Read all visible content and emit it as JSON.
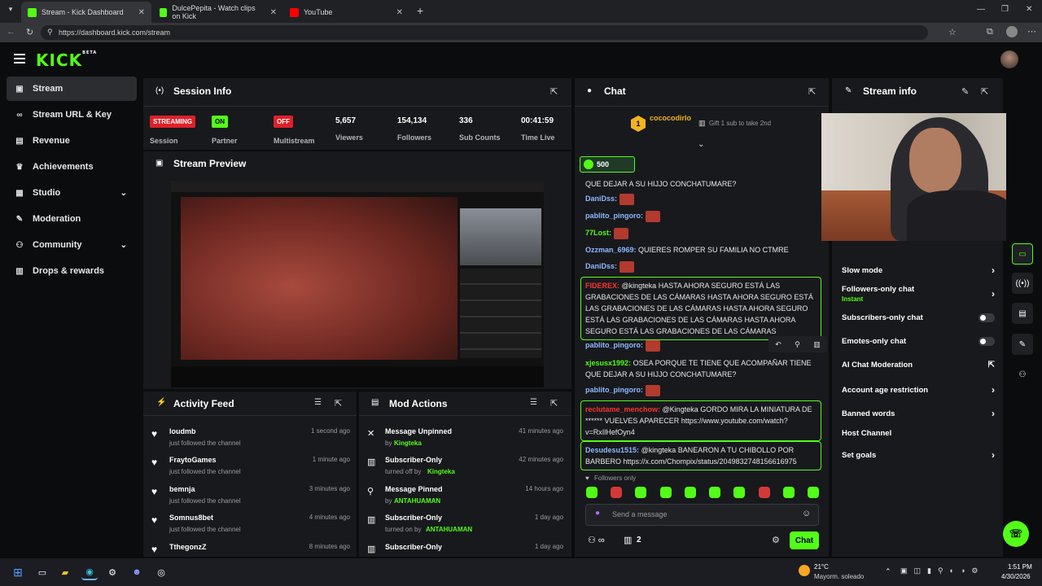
{
  "browser": {
    "tabs": [
      {
        "label": "Stream - Kick Dashboard",
        "icon": "kick-icon"
      },
      {
        "label": "DulcePepita - Watch clips on Kick",
        "icon": "kick-icon"
      },
      {
        "label": "YouTube",
        "icon": "youtube-icon"
      }
    ],
    "url": "https://dashboard.kick.com/stream"
  },
  "app": {
    "logo": "KICK",
    "logo_sup": "BETA"
  },
  "sidebar": {
    "items": [
      {
        "label": "Stream",
        "icon": "stream-icon"
      },
      {
        "label": "Stream URL & Key",
        "icon": "link-icon"
      },
      {
        "label": "Revenue",
        "icon": "revenue-icon"
      },
      {
        "label": "Achievements",
        "icon": "trophy-icon"
      },
      {
        "label": "Studio",
        "icon": "studio-icon"
      },
      {
        "label": "Moderation",
        "icon": "wrench-icon"
      },
      {
        "label": "Community",
        "icon": "community-icon"
      },
      {
        "label": "Drops & rewards",
        "icon": "gift-icon"
      }
    ]
  },
  "session": {
    "title": "Session Info",
    "streaming_badge": "STREAMING",
    "streaming_label": "Session",
    "partner_badge": "ON",
    "partner_label": "Partner",
    "multistream_badge": "OFF",
    "multistream_label": "Multistream",
    "viewers": "5,657",
    "viewers_label": "Viewers",
    "followers": "154,134",
    "followers_label": "Followers",
    "subs": "336",
    "subs_label": "Sub Counts",
    "time": "00:41:59",
    "time_label": "Time Live"
  },
  "preview": {
    "title": "Stream Preview"
  },
  "activity": {
    "title": "Activity Feed",
    "items": [
      {
        "user": "loudmb",
        "action": "just followed the channel",
        "time": "1 second ago"
      },
      {
        "user": "FraytoGames",
        "action": "just followed the channel",
        "time": "1 minute ago"
      },
      {
        "user": "bemnja",
        "action": "just followed the channel",
        "time": "3 minutes ago"
      },
      {
        "user": "Somnus8bet",
        "action": "just followed the channel",
        "time": "4 minutes ago"
      },
      {
        "user": "TthegonzZ",
        "action": "",
        "time": "8 minutes ago"
      }
    ]
  },
  "mod": {
    "title": "Mod Actions",
    "items": [
      {
        "action": "Message Unpinned",
        "prefix": "by",
        "user": "Kingteka",
        "time": "41 minutes ago"
      },
      {
        "action": "Subscriber-Only",
        "prefix": "turned off by",
        "user": "Kingteka",
        "time": "42 minutes ago"
      },
      {
        "action": "Message Pinned",
        "prefix": "by",
        "user": "ANTAHUAMAN",
        "time": "14 hours ago"
      },
      {
        "action": "Subscriber-Only",
        "prefix": "turned on by",
        "user": "ANTAHUAMAN",
        "time": "1 day ago"
      },
      {
        "action": "Subscriber-Only",
        "prefix": "",
        "user": "",
        "time": "1 day ago"
      }
    ]
  },
  "chat": {
    "title": "Chat",
    "top_gifter": "cococodirlo",
    "top_gifter_rank": "1",
    "gift_hint": "Gift 1 sub to take 2nd",
    "goal": "500",
    "messages": [
      {
        "user": "",
        "text": "QUE DEJAR A SU HIJJO CONCHATUMARE?",
        "color": "#e8e8e8"
      },
      {
        "user": "DaniDss:",
        "text": "",
        "color": "#8fb8ff"
      },
      {
        "user": "pablito_pingoro:",
        "text": "",
        "color": "#8fb8ff"
      },
      {
        "user": "77Lost:",
        "text": "",
        "color": "#53fc18"
      },
      {
        "user": "Ozzman_6969:",
        "text": "QUIERES ROMPER SU FAMILIA NO CTMRE",
        "color": "#8fb8ff"
      },
      {
        "user": "DaniDss:",
        "text": "",
        "color": "#8fb8ff"
      },
      {
        "user": "FIDEREX:",
        "text": "@kingteka HASTA AHORA SEGURO ESTÁ LAS GRABACIONES DE LAS CÁMARAS HASTA AHORA SEGURO ESTÁ LAS GRABACIONES DE LAS CÁMARAS HASTA AHORA SEGURO ESTÁ LAS GRABACIONES DE LAS CÁMARAS HASTA AHORA SEGURO ESTÁ LAS GRABACIONES DE LAS CÁMARAS",
        "color": "#ff3030",
        "highlight": true
      },
      {
        "user": "pablito_pingoro:",
        "text": "",
        "color": "#8fb8ff"
      },
      {
        "user": "xjesusx1992:",
        "text": "OSEA PORQUE TE TIENE QUE ACOMPAÑAR TIENE QUE DEJAR A SU HIJJO CONCHATUMARE?",
        "color": "#53fc18"
      },
      {
        "user": "pablito_pingoro:",
        "text": "",
        "color": "#8fb8ff"
      },
      {
        "user": "reclutame_menchow:",
        "text": "@Kingteka GORDO MIRA LA MINIATURA DE ****** VUELVES APARECER https://www.youtube.com/watch?v=RxIlHefOyn4",
        "color": "#ff3030",
        "highlight": true
      },
      {
        "user": "Desudesu1515:",
        "text": "@kingteka BANEARON A TU CHIBOLLO POR BARBERO https://x.com/Chompix/status/2049832748156616975",
        "color": "#8fb8ff",
        "highlight": true
      }
    ],
    "followers_only": "Followers only",
    "input_placeholder": "Send a message",
    "gift_count": "2",
    "send_label": "Chat"
  },
  "streaminfo": {
    "title": "Stream info",
    "settings": [
      {
        "label": "Slow mode",
        "sub": "",
        "control": "chevron"
      },
      {
        "label": "Followers-only chat",
        "sub": "Instant",
        "control": "chevron"
      },
      {
        "label": "Subscribers-only chat",
        "sub": "",
        "control": "toggle"
      },
      {
        "label": "Emotes-only chat",
        "sub": "",
        "control": "toggle"
      },
      {
        "label": "AI Chat Moderation",
        "sub": "",
        "control": "external"
      },
      {
        "label": "Account age restriction",
        "sub": "",
        "control": "chevron"
      },
      {
        "label": "Banned words",
        "sub": "",
        "control": "chevron"
      },
      {
        "label": "Host Channel",
        "sub": "",
        "control": "none"
      },
      {
        "label": "Set goals",
        "sub": "",
        "control": "chevron"
      }
    ]
  },
  "taskbar": {
    "weather_temp": "21°C",
    "weather_desc": "Mayorm. soleado",
    "time": "1:51 PM",
    "date": "4/30/2026"
  },
  "colors": {
    "accent": "#53fc18",
    "panel": "#18191c",
    "bg": "#0b0c0e",
    "live_red": "#e0202a"
  }
}
